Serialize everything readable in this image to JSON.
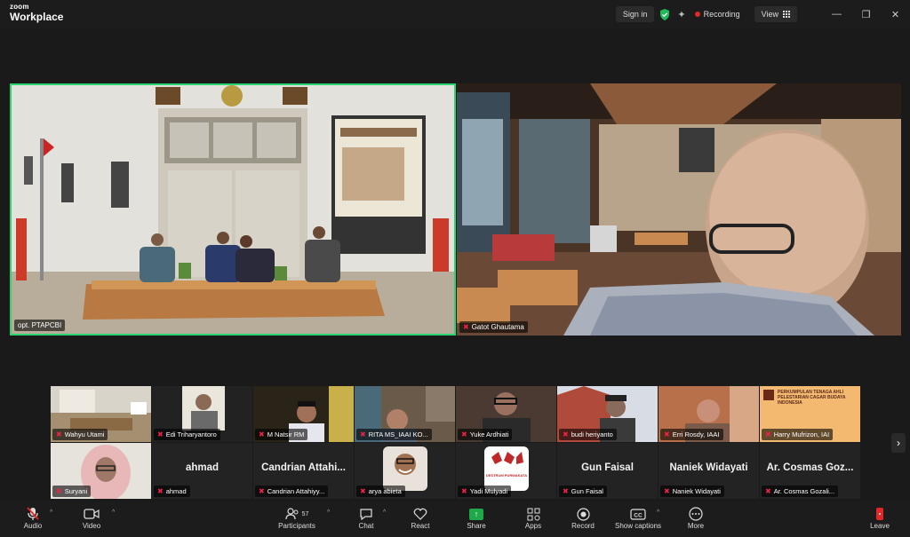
{
  "app": {
    "logo_top": "zoom",
    "logo_bottom": "Workplace"
  },
  "titlebar": {
    "signin": "Sign in",
    "recording": "Recording",
    "view": "View"
  },
  "main_videos": [
    {
      "label": "opt. PTAPCBI",
      "muted": false
    },
    {
      "label": "Gatot Ghautama",
      "muted": true
    }
  ],
  "gallery": [
    {
      "label": "Wahyu Utami",
      "name": "",
      "muted": true
    },
    {
      "label": "Edi Triharyantoro",
      "name": "",
      "muted": true
    },
    {
      "label": "M Natsir RM",
      "name": "",
      "muted": true
    },
    {
      "label": "RITA MS_IAAI KO...",
      "name": "",
      "muted": true
    },
    {
      "label": "Yuke Ardhiati",
      "name": "",
      "muted": true
    },
    {
      "label": "budi heriyanto",
      "name": "",
      "muted": true
    },
    {
      "label": "Erri Rosdy, IAAI",
      "name": "",
      "muted": true
    },
    {
      "label": "Harry Mufrizon, IAI",
      "name": "",
      "muted": true
    },
    {
      "label": "Suryani",
      "name": "",
      "muted": true
    },
    {
      "label": "ahmad",
      "name": "ahmad",
      "muted": true
    },
    {
      "label": "Candrian Attahiyy...",
      "name": "Candrian  Attahi...",
      "muted": true
    },
    {
      "label": "arya abieta",
      "name": "",
      "muted": true
    },
    {
      "label": "Yadi Mulyadi",
      "name": "",
      "muted": true
    },
    {
      "label": "Gun Faisal",
      "name": "Gun Faisal",
      "muted": true
    },
    {
      "label": "Naniek Widayati",
      "name": "Naniek Widayati",
      "muted": true
    },
    {
      "label": "Ar. Cosmas Gozali...",
      "name": "Ar. Cosmas  Goz...",
      "muted": true
    }
  ],
  "tile_texts": {
    "harry_banner": "PERKUMPULAN TENAGA AHLI PELESTARIAN CAGAR BUDAYA INDONESIA",
    "yadi_logo": "DESTRUM PURWAKATA"
  },
  "toolbar": {
    "audio": "Audio",
    "video": "Video",
    "participants": "Participants",
    "participants_count": "57",
    "chat": "Chat",
    "react": "React",
    "share": "Share",
    "apps": "Apps",
    "record": "Record",
    "captions": "Show captions",
    "more": "More",
    "leave": "Leave"
  },
  "colors": {
    "active_speaker": "#2bd46e",
    "share": "#1fa84a",
    "muted": "#e22244",
    "recording": "#e02828"
  }
}
